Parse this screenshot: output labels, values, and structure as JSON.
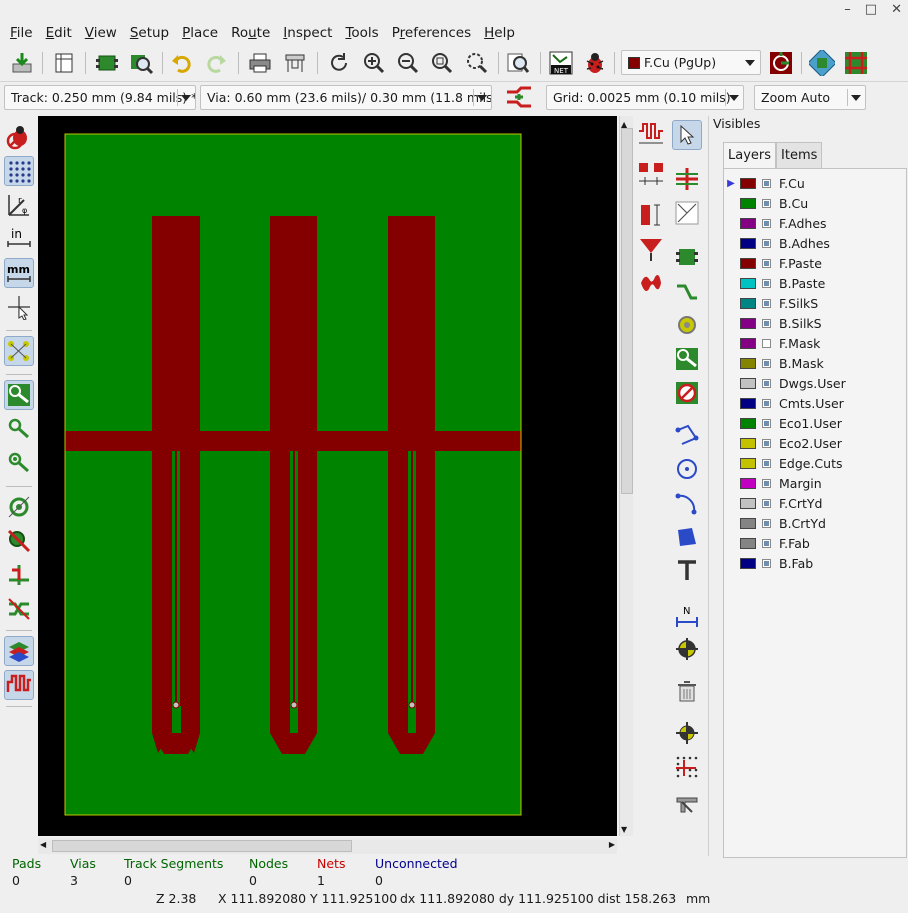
{
  "window": {
    "minimize": "–",
    "maximize": "□",
    "close": "✕"
  },
  "menu": [
    {
      "pre": "",
      "u": "F",
      "post": "ile"
    },
    {
      "pre": "",
      "u": "E",
      "post": "dit"
    },
    {
      "pre": "",
      "u": "V",
      "post": "iew"
    },
    {
      "pre": "",
      "u": "S",
      "post": "etup"
    },
    {
      "pre": "",
      "u": "P",
      "post": "lace"
    },
    {
      "pre": "Ro",
      "u": "u",
      "post": "te"
    },
    {
      "pre": "",
      "u": "I",
      "post": "nspect"
    },
    {
      "pre": "",
      "u": "T",
      "post": "ools"
    },
    {
      "pre": "P",
      "u": "r",
      "post": "eferences"
    },
    {
      "pre": "",
      "u": "H",
      "post": "elp"
    }
  ],
  "toolbar": {
    "layer_select": "F.Cu (PgUp)",
    "layer_color": "#840000"
  },
  "combos": {
    "track": "Track: 0.250 mm (9.84 mils) *",
    "via": "Via: 0.60 mm (23.6 mils)/ 0.30 mm (11.8 mils) *",
    "grid": "Grid: 0.0025 mm (0.10 mils)",
    "zoom": "Zoom Auto"
  },
  "panel": {
    "title": "Visibles",
    "tabs": [
      "Layers",
      "Items"
    ],
    "active_tab": "Layers",
    "layers": [
      {
        "name": "F.Cu",
        "color": "#840000",
        "checked": true,
        "active": true
      },
      {
        "name": "B.Cu",
        "color": "#008400",
        "checked": true
      },
      {
        "name": "F.Adhes",
        "color": "#840084",
        "checked": true
      },
      {
        "name": "B.Adhes",
        "color": "#000084",
        "checked": true
      },
      {
        "name": "F.Paste",
        "color": "#840000",
        "checked": true
      },
      {
        "name": "B.Paste",
        "color": "#00c2c2",
        "checked": true
      },
      {
        "name": "F.SilkS",
        "color": "#008484",
        "checked": true
      },
      {
        "name": "B.SilkS",
        "color": "#840084",
        "checked": true
      },
      {
        "name": "F.Mask",
        "color": "#840084",
        "checked": false
      },
      {
        "name": "B.Mask",
        "color": "#848400",
        "checked": true
      },
      {
        "name": "Dwgs.User",
        "color": "#c2c2c2",
        "checked": true
      },
      {
        "name": "Cmts.User",
        "color": "#000084",
        "checked": true
      },
      {
        "name": "Eco1.User",
        "color": "#008400",
        "checked": true
      },
      {
        "name": "Eco2.User",
        "color": "#c2c200",
        "checked": true
      },
      {
        "name": "Edge.Cuts",
        "color": "#c2c200",
        "checked": true
      },
      {
        "name": "Margin",
        "color": "#c200c2",
        "checked": true
      },
      {
        "name": "F.CrtYd",
        "color": "#c2c2c2",
        "checked": true
      },
      {
        "name": "B.CrtYd",
        "color": "#848484",
        "checked": true
      },
      {
        "name": "F.Fab",
        "color": "#848484",
        "checked": true
      },
      {
        "name": "B.Fab",
        "color": "#000084",
        "checked": true
      }
    ]
  },
  "status": {
    "pads_label": "Pads",
    "pads": "0",
    "vias_label": "Vias",
    "vias": "3",
    "tracks_label": "Track Segments",
    "tracks": "0",
    "nodes_label": "Nodes",
    "nodes": "0",
    "nets_label": "Nets",
    "nets": "1",
    "unconnected_label": "Unconnected",
    "unconnected": "0",
    "zoom": "Z 2.38",
    "xy": "X 111.892080  Y 111.925100",
    "dxy": "dx 111.892080  dy 111.925100  dist 158.263",
    "units": "mm"
  },
  "colors": {
    "fcu": "#840000",
    "bcu": "#008400",
    "edge": "#c2c200",
    "background": "#000000",
    "status_label": "#006400",
    "nets_label": "#c80000",
    "unconnected_label": "#00008c"
  },
  "icons": {
    "left": [
      "drc-off-icon",
      "grid-dots-icon",
      "polar-coords-icon",
      "inch-units-icon",
      "mm-units-icon",
      "cursor-shape-icon",
      "ratsnest-icon",
      "pad-sketch-icon",
      "via-sketch-icon",
      "track-sketch-icon",
      "zone-outline-icon",
      "zone-fill-icon",
      "zone-off-icon",
      "high-contrast-icon",
      "layers-manager-icon",
      "microwave-toolbar-icon"
    ],
    "right": [
      "select-icon",
      "footprint-icon",
      "route-track-icon",
      "ratsnest-local-icon",
      "via-icon",
      "zone-icon",
      "keepout-icon",
      "line-icon",
      "circle-icon",
      "arc-icon",
      "polygon-icon",
      "text-icon",
      "dimension-icon",
      "target-icon",
      "delete-icon",
      "origin-icon",
      "grid-origin-icon",
      "measure-icon"
    ]
  }
}
